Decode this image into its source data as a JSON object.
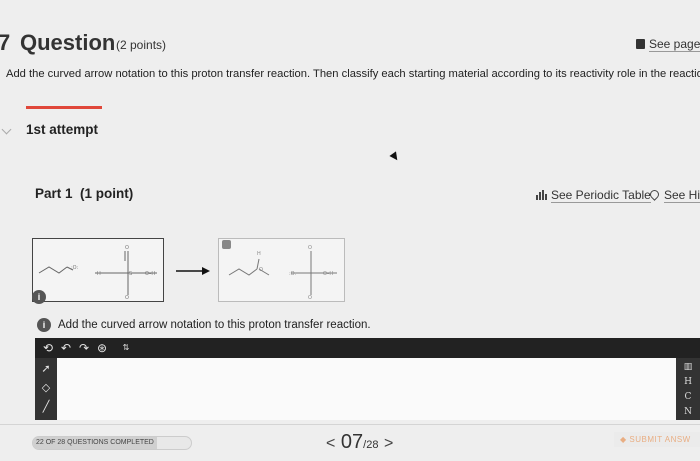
{
  "question": {
    "number": "7",
    "title": "Question",
    "points": "(2 points)",
    "see_page": "See page",
    "instruction": "Add the curved arrow notation to this proton transfer reaction. Then classify each starting material according to its reactivity role in the reaction."
  },
  "attempt": {
    "label": "1st attempt"
  },
  "part": {
    "title": "Part 1",
    "points": "(1 point)",
    "periodic_table": "See Periodic Table",
    "hint": "See Hint"
  },
  "reaction": {
    "info_badge": "i",
    "instruction": "Add the curved arrow notation to this proton transfer reaction."
  },
  "editor": {
    "tools": [
      "select-icon",
      "undo-icon",
      "redo-icon",
      "zoom-icon",
      "template-icon"
    ],
    "left_tools": [
      "pointer-icon",
      "eraser-icon",
      "bond-icon"
    ],
    "elements": [
      "H",
      "C",
      "N"
    ]
  },
  "footer": {
    "completed_text": "22 OF 28 QUESTIONS COMPLETED",
    "completed_fraction": 0.786,
    "page_current": "07",
    "page_total": "/28",
    "submit": "SUBMIT ANSW"
  },
  "colors": {
    "accent": "#e0473a",
    "toolbar": "#222222",
    "submit_text": "#e9ae83"
  }
}
